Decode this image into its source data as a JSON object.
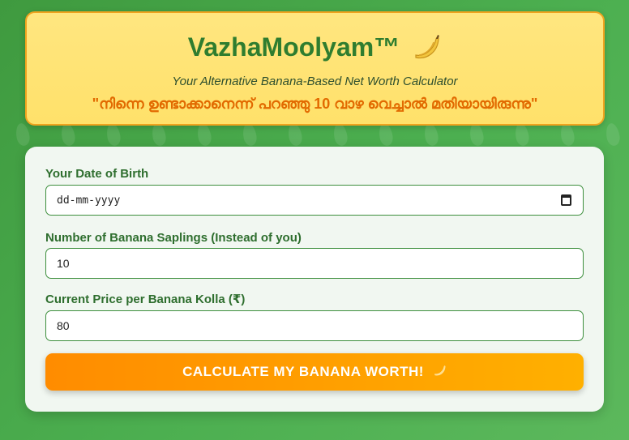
{
  "header": {
    "title": "VazhaMoolyam™",
    "tagline": "Your Alternative Banana-Based Net Worth Calculator",
    "quote": "\"നിന്നെ ഉണ്ടാക്കാനെന്ന് പറഞ്ഞു 10 വാഴ വെച്ചാൽ മതിയായിരുന്നു\"",
    "title_icon": "banana-icon"
  },
  "form": {
    "dob": {
      "label": "Your Date of Birth",
      "placeholder": "dd-mm-yyyy"
    },
    "saplings": {
      "label": "Number of Banana Saplings (Instead of you)",
      "value": "10"
    },
    "price": {
      "label": "Current Price per Banana Kolla (₹)",
      "value": "80"
    },
    "submit": {
      "label": "CALCULATE MY BANANA WORTH!",
      "icon": "banana-icon"
    }
  },
  "colors": {
    "background": "#4caf50",
    "header_bg": "#ffe16a",
    "title": "#2f7d2f",
    "quote": "#e26a00",
    "button_start": "#ff8c00",
    "button_end": "#ffb000"
  }
}
